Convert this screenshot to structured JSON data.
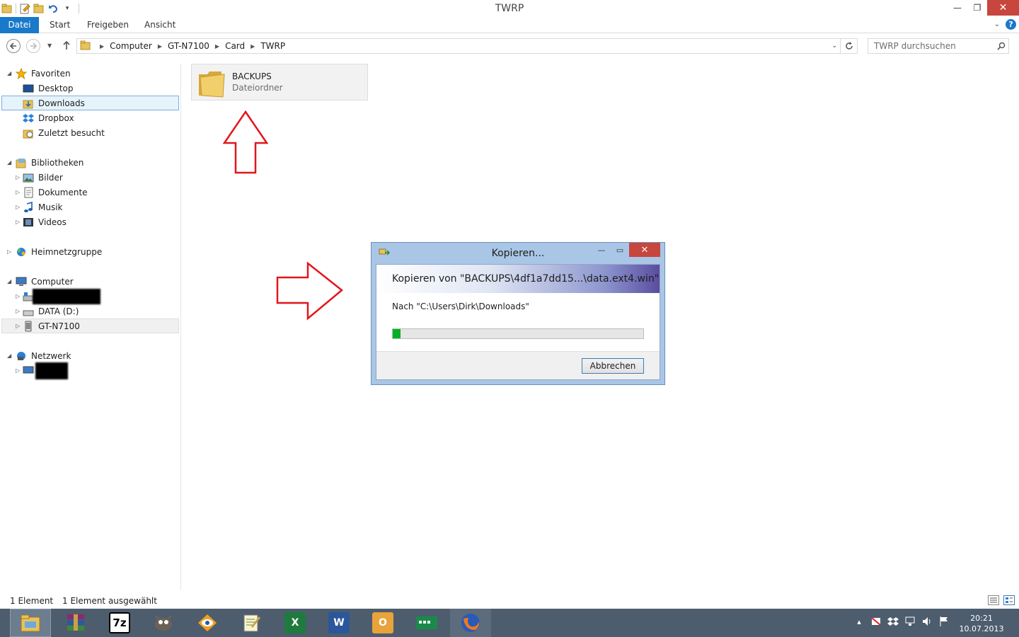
{
  "window": {
    "title": "TWRP",
    "controls": {
      "minimize": "—",
      "restore": "❐",
      "close": "✕"
    }
  },
  "ribbon": {
    "tabs": [
      "Datei",
      "Start",
      "Freigeben",
      "Ansicht"
    ],
    "help": "?"
  },
  "address": {
    "breadcrumbs": [
      "Computer",
      "GT-N7100",
      "Card",
      "TWRP"
    ],
    "search_placeholder": "TWRP durchsuchen"
  },
  "nav": {
    "favorites": {
      "label": "Favoriten",
      "items": [
        "Desktop",
        "Downloads",
        "Dropbox",
        "Zuletzt besucht"
      ],
      "selected": "Downloads"
    },
    "libraries": {
      "label": "Bibliotheken",
      "items": [
        "Bilder",
        "Dokumente",
        "Musik",
        "Videos"
      ]
    },
    "homegroup": {
      "label": "Heimnetzgruppe"
    },
    "computer": {
      "label": "Computer",
      "items": [
        "DATA (D:)",
        "GT-N7100"
      ]
    },
    "network": {
      "label": "Netzwerk"
    }
  },
  "content": {
    "folder": {
      "name": "BACKUPS",
      "type": "Dateiordner"
    }
  },
  "dialog": {
    "title": "Kopieren...",
    "heading": "Kopieren von \"BACKUPS\\4df1a7dd15...\\data.ext4.win\"",
    "destination": "Nach \"C:\\Users\\Dirk\\Downloads\"",
    "progress": 0.03,
    "cancel_label": "Abbrechen",
    "controls": {
      "minimize": "—",
      "maximize": "▭",
      "close": "✕"
    }
  },
  "status": {
    "count": "1 Element",
    "selected": "1 Element ausgewählt"
  },
  "taskbar": {
    "apps": [
      "file-explorer",
      "winrar",
      "7-zip",
      "gimp",
      "photo-viewer",
      "notepad",
      "excel",
      "word",
      "outlook",
      "network-tool",
      "firefox"
    ],
    "clock_time": "20:21",
    "clock_date": "10.07.2013"
  },
  "colors": {
    "accent": "#1979ca",
    "close_red": "#c7463e",
    "progress_green": "#06b025",
    "arrow_red": "#e2161b",
    "taskbar": "#4d5d6e"
  }
}
